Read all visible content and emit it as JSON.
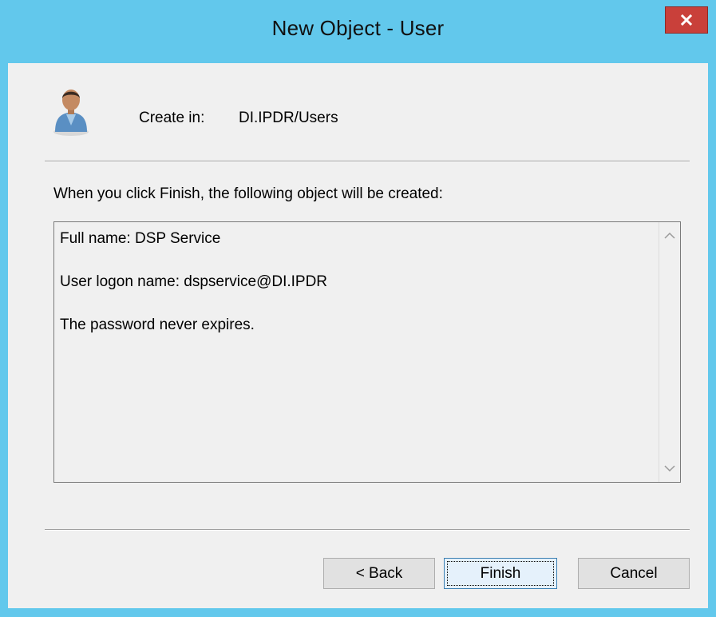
{
  "window": {
    "title": "New Object - User",
    "close_label": "x",
    "accent_color": "#62c8ec",
    "close_color": "#c9403a"
  },
  "header": {
    "icon": "user-icon",
    "create_in_label": "Create in:",
    "create_in_value": "DI.IPDR/Users"
  },
  "body": {
    "intro_text": "When you click Finish, the following object will be created:",
    "summary_lines": [
      "Full name: DSP Service",
      "User logon name: dspservice@DI.IPDR",
      "The password never expires."
    ]
  },
  "buttons": {
    "back": "< Back",
    "finish": "Finish",
    "cancel": "Cancel"
  }
}
